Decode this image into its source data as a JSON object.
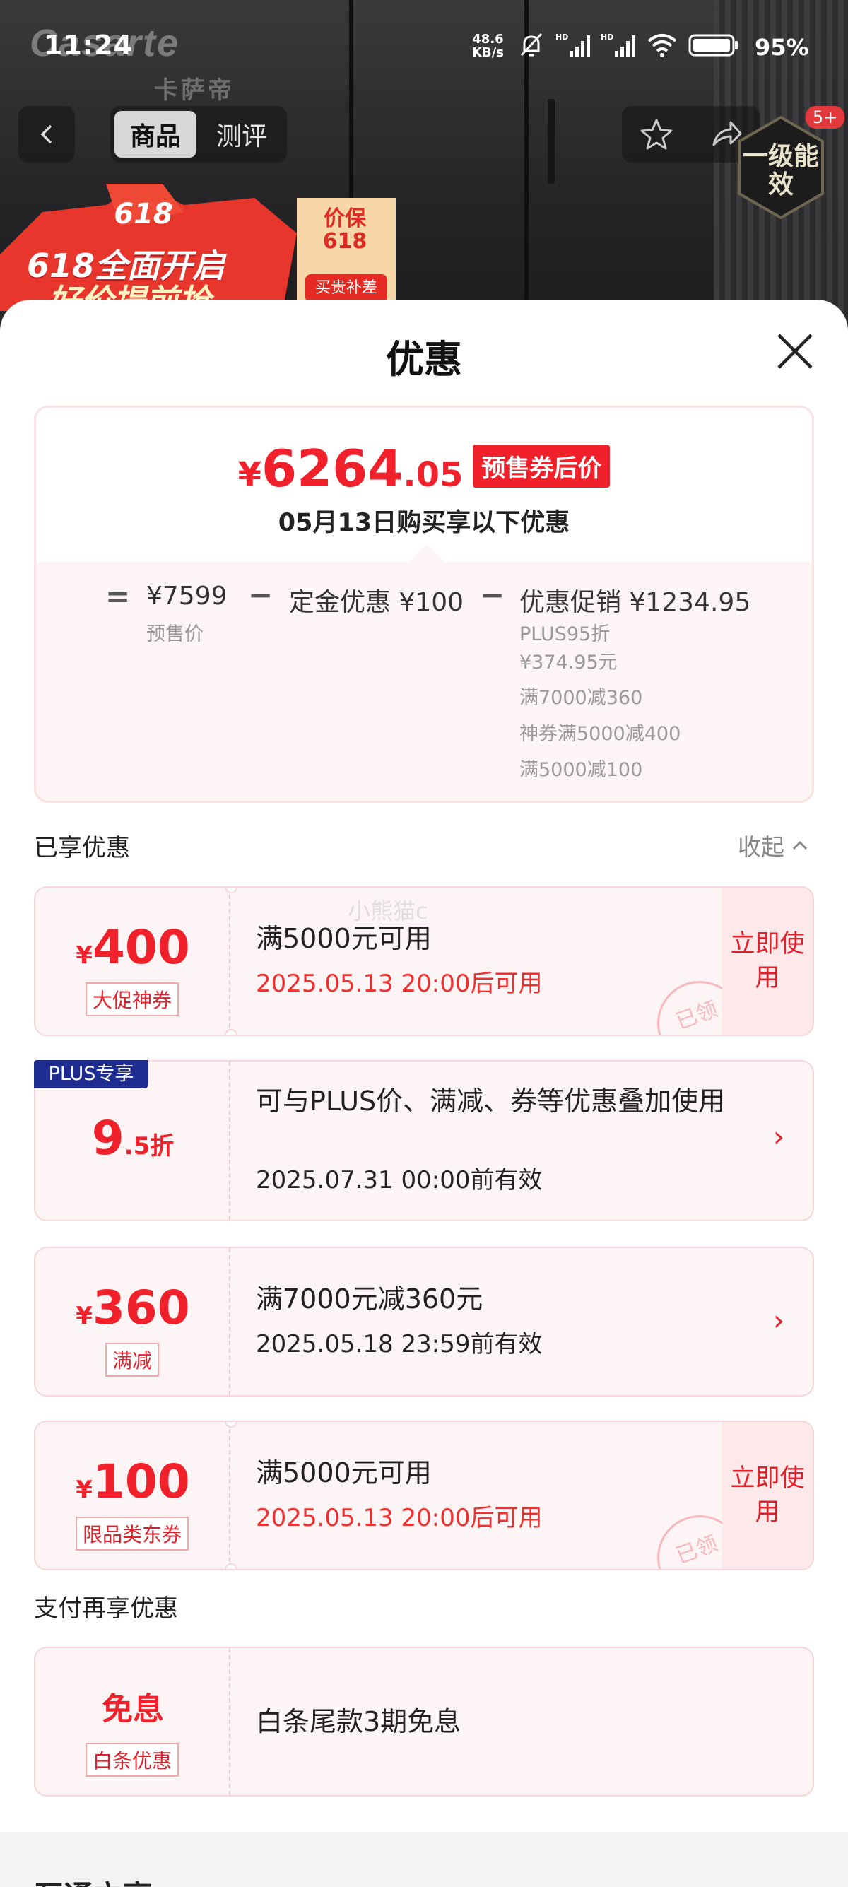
{
  "status_bar": {
    "time": "11:24",
    "net_speed_value": "48.6",
    "net_speed_unit": "KB/s",
    "battery": "95%"
  },
  "backdrop": {
    "brand": "Casarte",
    "brand_cn": "卡萨帝",
    "promo_618": "618",
    "promo_line1": "618全面开启",
    "promo_line2": "好价提前抢",
    "promo_tag": "价保618",
    "promo_tag_sub": "买贵补差",
    "energy_label": "一级能效",
    "badge": "5+"
  },
  "nav": {
    "tabs": [
      {
        "label": "商品",
        "active": true
      },
      {
        "label": "测评",
        "active": false
      }
    ]
  },
  "sheet": {
    "title": "优惠",
    "price": {
      "yen": "¥",
      "integer": "6264",
      "decimal": ".05",
      "badge": "预售券后价",
      "subtitle": "05月13日购买享以下优惠"
    },
    "formula": {
      "eq": "=",
      "presale_price": "¥7599",
      "presale_label": "预售价",
      "minus1": "−",
      "deposit": "定金优惠 ¥100",
      "minus2": "−",
      "promo": "优惠促销 ¥1234.95",
      "details": [
        "PLUS95折",
        "¥374.95元",
        "满7000减360",
        "神券满5000减400",
        "满5000减100"
      ]
    },
    "enjoyed_label": "已享优惠",
    "collapse_label": "收起",
    "watermark": "小熊猫c",
    "coupons": [
      {
        "yen": "¥",
        "amount": "400",
        "tag": "大促神券",
        "title": "满5000元可用",
        "subtitle": "2025.05.13 20:00后可用",
        "action": "立即使用",
        "stamp": "已领"
      },
      {
        "plus_tag": "PLUS专享",
        "amount": "9",
        "suffix": ".5折",
        "title": "可与PLUS价、满减、券等优惠叠加使用",
        "subtitle": "2025.07.31 00:00前有效"
      },
      {
        "yen": "¥",
        "amount": "360",
        "tag": "满减",
        "title": "满7000元减360元",
        "subtitle": "2025.05.18 23:59前有效"
      },
      {
        "yen": "¥",
        "amount": "100",
        "tag": "限品类东券",
        "title": "满5000元可用",
        "subtitle": "2025.05.13 20:00后可用",
        "action": "立即使用",
        "stamp": "已领"
      }
    ],
    "pay_label": "支付再享优惠",
    "pay_card": {
      "amount": "免息",
      "tag": "白条优惠",
      "title": "白条尾款3期免息"
    },
    "next_section": "互通立享"
  },
  "colors": {
    "accent": "#f0212b",
    "plus": "#1f2c8f",
    "card_bg": "#fdf5f5"
  }
}
